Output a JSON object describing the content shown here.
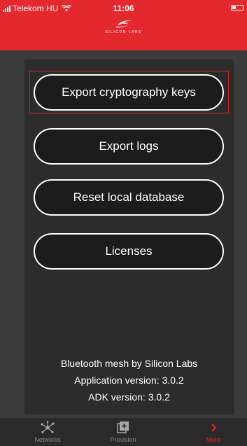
{
  "status_bar": {
    "carrier": "Telekom HU",
    "time": "11:06"
  },
  "header": {
    "brand_text": "SILICON LABS"
  },
  "actions": [
    {
      "label": "Export cryptography keys"
    },
    {
      "label": "Export logs"
    },
    {
      "label": "Reset local database"
    },
    {
      "label": "Licenses"
    }
  ],
  "info": {
    "line1": "Bluetooth mesh by Silicon Labs",
    "line2": "Application version: 3.0.2",
    "line3": "ADK version: 3.0.2"
  },
  "tabs": [
    {
      "label": "Networks",
      "icon": "network-icon",
      "active": false
    },
    {
      "label": "Provision",
      "icon": "provision-icon",
      "active": false
    },
    {
      "label": "More",
      "icon": "chevron-right-icon",
      "active": true
    }
  ],
  "colors": {
    "brand_red": "#e3282e",
    "background": "#3b3b3b",
    "button_fill": "#1c1c1c"
  }
}
